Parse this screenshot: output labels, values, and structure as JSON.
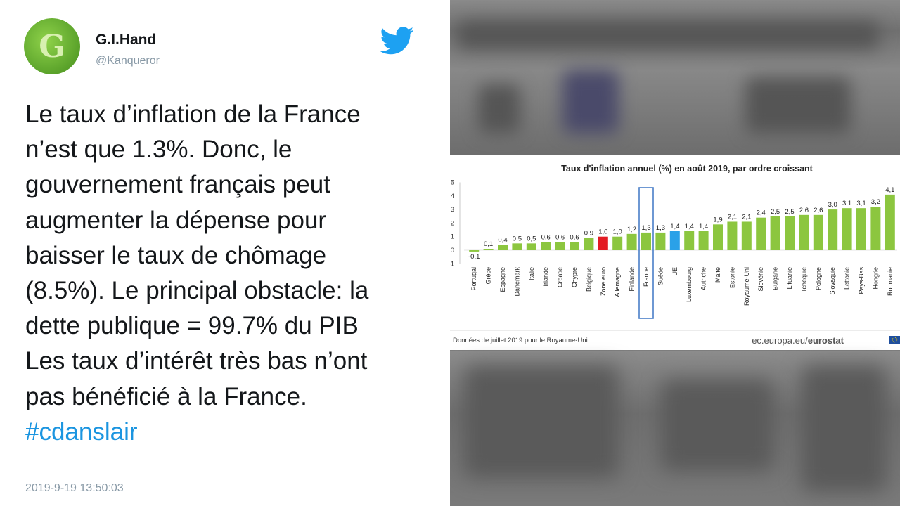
{
  "tweet": {
    "author_name": "G.I.Hand",
    "author_handle": "@Kanqueror",
    "avatar_letter": "G",
    "lines": [
      "Le taux d’inflation de la France",
      "n’est que 1.3%. Donc, le",
      "gouvernement français peut",
      "augmenter la dépense pour",
      "baisser le taux de chômage",
      "(8.5%). Le principal obstacle: la",
      "dette publique = 99.7% du PIB",
      "Les taux d’intérêt très bas n’ont",
      "pas bénéficié à la France."
    ],
    "hashtag": "#cdanslair",
    "timestamp": "2019-9-19 13:50:03",
    "icon": "twitter-bird-icon",
    "colors": {
      "brand": "#1da1f2",
      "hashtag": "#1b95e0",
      "text": "#14171a",
      "muted": "#8899a6"
    }
  },
  "chart_data": {
    "type": "bar",
    "title": "Taux d'inflation annuel (%) en août 2019, par ordre croissant",
    "categories": [
      "Portugal",
      "Grèce",
      "Espagne",
      "Danemark",
      "Italie",
      "Irlande",
      "Croatie",
      "Chypre",
      "Belgique",
      "Zone euro",
      "Allemagne",
      "Finlande",
      "France",
      "Suède",
      "UE",
      "Luxembourg",
      "Autriche",
      "Malte",
      "Estonie",
      "Royaume-Uni",
      "Slovénie",
      "Bulgarie",
      "Lituanie",
      "Tchéquie",
      "Pologne",
      "Slovaquie",
      "Lettonie",
      "Pays-Bas",
      "Hongrie",
      "Roumanie"
    ],
    "values": [
      -0.1,
      0.1,
      0.4,
      0.5,
      0.5,
      0.6,
      0.6,
      0.6,
      0.9,
      1.0,
      1.0,
      1.2,
      1.3,
      1.3,
      1.4,
      1.4,
      1.4,
      1.9,
      2.1,
      2.1,
      2.4,
      2.5,
      2.5,
      2.6,
      2.6,
      3.0,
      3.1,
      3.1,
      3.2,
      4.1
    ],
    "value_labels": [
      "-0,1",
      "0,1",
      "0,4",
      "0,5",
      "0,5",
      "0,6",
      "0,6",
      "0,6",
      "0,9",
      "1,0",
      "1,0",
      "1,2",
      "1,3",
      "1,3",
      "1,4",
      "1,4",
      "1,4",
      "1,9",
      "2,1",
      "2,1",
      "2,4",
      "2,5",
      "2,5",
      "2,6",
      "2,6",
      "3,0",
      "3,1",
      "3,1",
      "3,2",
      "4,1"
    ],
    "bar_colors": {
      "default": "#8cc63f",
      "Zone euro": "#e31b23",
      "UE": "#2aa1e8"
    },
    "highlight_box": "France",
    "yticks": [
      5,
      4,
      3,
      2,
      1,
      0,
      -1
    ],
    "ylim": [
      -1,
      5
    ],
    "grid": false,
    "footnote": "Données de juillet 2019 pour le Royaume-Uni.",
    "source": "ec.europa.eu/",
    "source_brand": "eurostat"
  }
}
